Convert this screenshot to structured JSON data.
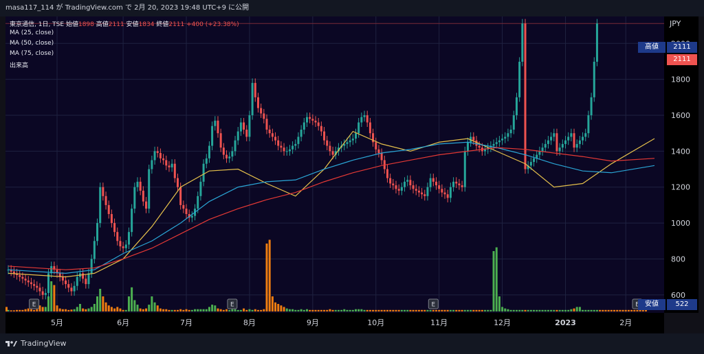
{
  "header": {
    "text": "masa117_114 が TradingView.com で 2月 20, 2023 19:48 UTC+9 に公開"
  },
  "legend": {
    "symbol": "東京通信, 1日, TSE",
    "open_label": "始値",
    "open": "1898",
    "high_label": "高値",
    "high": "2111",
    "low_label": "安値",
    "low": "1834",
    "close_label": "終値",
    "close": "2111",
    "change": "+400 (+23.38%)",
    "ma1": "MA (25, close)",
    "ma2": "MA (50, close)",
    "ma3": "MA (75, close)",
    "volume": "出来高"
  },
  "price_axis": {
    "currency": "JPY",
    "high_tag_label": "高値",
    "high_tag_value": "2111",
    "last_price": "2111",
    "low_tag_label": "安値",
    "low_tag_value": "522"
  },
  "footer": {
    "logo_text": "TradingView"
  },
  "earnings_marker": "E",
  "colors": {
    "up": "#26a69a",
    "down": "#ef5350",
    "ma25": "#e5c04b",
    "ma50": "#2aa6d6",
    "ma75": "#e53935",
    "vol_up": "#4caf50",
    "vol_down": "#ef7d10"
  },
  "chart_data": {
    "type": "candlestick",
    "title": "東京通信, 1日, TSE",
    "ylim": [
      500,
      2150
    ],
    "y_ticks": [
      600,
      800,
      1000,
      1200,
      1400,
      1600,
      1800,
      2000
    ],
    "x_tick_labels": [
      "5月",
      "6月",
      "7月",
      "8月",
      "9月",
      "10月",
      "11月",
      "12月",
      "2023",
      "2月"
    ],
    "x_tick_days": [
      17,
      40,
      62,
      84,
      106,
      128,
      150,
      172,
      194,
      215
    ],
    "earnings_days": [
      9,
      78,
      148,
      219
    ],
    "series": [
      {
        "name": "MA (25, close)",
        "x": [
          0,
          20,
          30,
          40,
          50,
          60,
          70,
          80,
          90,
          100,
          110,
          120,
          130,
          140,
          150,
          160,
          170,
          180,
          190,
          200,
          210,
          225
        ],
        "values": [
          720,
          700,
          720,
          800,
          980,
          1200,
          1290,
          1300,
          1220,
          1150,
          1300,
          1510,
          1440,
          1400,
          1450,
          1470,
          1400,
          1330,
          1200,
          1220,
          1330,
          1470
        ]
      },
      {
        "name": "MA (50, close)",
        "x": [
          0,
          20,
          30,
          40,
          50,
          60,
          70,
          80,
          90,
          100,
          110,
          120,
          130,
          140,
          150,
          160,
          170,
          180,
          190,
          200,
          210,
          225
        ],
        "values": [
          740,
          720,
          740,
          830,
          900,
          1000,
          1120,
          1200,
          1230,
          1240,
          1300,
          1350,
          1390,
          1410,
          1440,
          1450,
          1420,
          1380,
          1330,
          1290,
          1280,
          1320
        ]
      },
      {
        "name": "MA (75, close)",
        "x": [
          0,
          20,
          30,
          40,
          50,
          60,
          70,
          80,
          90,
          100,
          110,
          120,
          130,
          140,
          150,
          160,
          170,
          180,
          190,
          200,
          210,
          225
        ],
        "values": [
          760,
          740,
          750,
          800,
          860,
          940,
          1020,
          1080,
          1130,
          1170,
          1230,
          1280,
          1320,
          1350,
          1380,
          1400,
          1420,
          1410,
          1390,
          1370,
          1345,
          1360
        ]
      }
    ],
    "candles_x": [
      0,
      1,
      2,
      3,
      4,
      5,
      6,
      7,
      8,
      9,
      10,
      11,
      12,
      13,
      14,
      15,
      16,
      17,
      18,
      19,
      20,
      21,
      22,
      23,
      24,
      25,
      26,
      27,
      28,
      29,
      30,
      31,
      32,
      33,
      34,
      35,
      36,
      37,
      38,
      39,
      40,
      41,
      42,
      43,
      44,
      45,
      46,
      47,
      48,
      49,
      50,
      51,
      52,
      53,
      54,
      55,
      56,
      57,
      58,
      59,
      60,
      61,
      62,
      63,
      64,
      65,
      66,
      67,
      68,
      69,
      70,
      71,
      72,
      73,
      74,
      75,
      76,
      77,
      78,
      79,
      80,
      81,
      82,
      83,
      84,
      85,
      86,
      87,
      88,
      89,
      90,
      91,
      92,
      93,
      94,
      95,
      96,
      97,
      98,
      99,
      100,
      101,
      102,
      103,
      104,
      105,
      106,
      107,
      108,
      109,
      110,
      111,
      112,
      113,
      114,
      115,
      116,
      117,
      118,
      119,
      120,
      121,
      122,
      123,
      124,
      125,
      126,
      127,
      128,
      129,
      130,
      131,
      132,
      133,
      134,
      135,
      136,
      137,
      138,
      139,
      140,
      141,
      142,
      143,
      144,
      145,
      146,
      147,
      148,
      149,
      150,
      151,
      152,
      153,
      154,
      155,
      156,
      157,
      158,
      159,
      160,
      161,
      162,
      163,
      164,
      165,
      166,
      167,
      168,
      169,
      170,
      171,
      172,
      173,
      174,
      175,
      176,
      177,
      178,
      179,
      180,
      181,
      182,
      183,
      184,
      185,
      186,
      187,
      188,
      189,
      190,
      191,
      192,
      193,
      194,
      195,
      196,
      197,
      198,
      199,
      200,
      201,
      202,
      203,
      204,
      205,
      206,
      207,
      208,
      209,
      210,
      211,
      212,
      213,
      214,
      215,
      216,
      217,
      218,
      219,
      220,
      221,
      222
    ],
    "close": [
      740,
      730,
      720,
      710,
      700,
      690,
      680,
      670,
      660,
      650,
      640,
      620,
      600,
      610,
      720,
      760,
      740,
      720,
      700,
      680,
      660,
      640,
      620,
      650,
      700,
      720,
      690,
      660,
      720,
      800,
      900,
      1000,
      1200,
      1150,
      1100,
      1050,
      1000,
      950,
      900,
      870,
      860,
      880,
      950,
      1080,
      1200,
      1230,
      1180,
      1120,
      1080,
      1300,
      1350,
      1400,
      1390,
      1360,
      1350,
      1320,
      1310,
      1330,
      1250,
      1200,
      1100,
      1080,
      1050,
      1030,
      1040,
      1080,
      1150,
      1230,
      1330,
      1360,
      1430,
      1540,
      1570,
      1500,
      1420,
      1380,
      1360,
      1370,
      1400,
      1460,
      1510,
      1560,
      1520,
      1480,
      1600,
      1780,
      1700,
      1640,
      1610,
      1580,
      1520,
      1500,
      1480,
      1460,
      1430,
      1420,
      1400,
      1400,
      1410,
      1430,
      1440,
      1480,
      1520,
      1560,
      1590,
      1580,
      1570,
      1560,
      1540,
      1510,
      1460,
      1430,
      1400,
      1380,
      1400,
      1420,
      1430,
      1440,
      1450,
      1460,
      1470,
      1500,
      1560,
      1590,
      1600,
      1560,
      1500,
      1450,
      1410,
      1390,
      1350,
      1300,
      1250,
      1220,
      1210,
      1190,
      1180,
      1200,
      1230,
      1240,
      1210,
      1190,
      1180,
      1170,
      1160,
      1150,
      1200,
      1250,
      1230,
      1210,
      1190,
      1170,
      1160,
      1140,
      1200,
      1230,
      1220,
      1210,
      1200,
      1400,
      1450,
      1480,
      1460,
      1430,
      1420,
      1400,
      1410,
      1420,
      1430,
      1440,
      1450,
      1460,
      1470,
      1480,
      1500,
      1520,
      1600,
      1700,
      1898,
      2111,
      1300,
      1320,
      1340,
      1360,
      1380,
      1400,
      1420,
      1440,
      1460,
      1480,
      1500,
      1400,
      1420,
      1440,
      1460,
      1480,
      1500,
      1420,
      1440,
      1460,
      1480,
      1500,
      1600,
      1700,
      1898,
      2111
    ],
    "volume_label": "出来高",
    "volume_ymax": 1000,
    "volume": [
      20,
      15,
      15,
      20,
      20,
      20,
      30,
      40,
      30,
      20,
      30,
      80,
      60,
      60,
      200,
      400,
      350,
      80,
      40,
      30,
      30,
      20,
      25,
      30,
      60,
      100,
      40,
      30,
      40,
      60,
      100,
      200,
      300,
      200,
      120,
      80,
      60,
      40,
      60,
      40,
      20,
      20,
      200,
      320,
      150,
      90,
      40,
      30,
      40,
      90,
      200,
      120,
      80,
      40,
      30,
      30,
      20,
      20,
      20,
      20,
      30,
      20,
      30,
      20,
      20,
      30,
      30,
      30,
      30,
      30,
      60,
      90,
      80,
      40,
      30,
      20,
      30,
      20,
      30,
      30,
      20,
      20,
      40,
      20,
      30,
      20,
      30,
      20,
      20,
      30,
      900,
      950,
      200,
      120,
      100,
      80,
      60,
      40,
      30,
      30,
      20,
      20,
      30,
      20,
      30,
      20,
      20,
      20,
      20,
      20,
      20,
      20,
      30,
      20,
      20,
      20,
      20,
      30,
      20,
      20,
      20,
      30,
      30,
      30,
      20,
      20,
      20,
      20,
      20,
      20,
      20,
      20,
      20,
      20,
      20,
      20,
      20,
      20,
      20,
      20,
      20,
      20,
      20,
      20,
      20,
      20,
      20,
      20,
      20,
      20,
      20,
      20,
      20,
      20,
      20,
      20,
      20,
      20,
      20,
      20,
      20,
      20,
      20,
      20,
      20,
      20,
      20,
      20,
      20,
      800,
      850,
      200,
      60,
      40,
      30,
      20,
      20,
      20,
      20,
      20,
      20,
      20,
      20,
      20,
      20,
      20,
      20,
      20,
      20,
      20,
      20,
      20,
      20,
      20,
      20,
      20,
      30,
      40,
      60,
      60,
      20,
      20,
      20,
      20,
      20,
      20,
      20,
      20,
      20,
      20,
      20,
      20,
      20,
      20,
      20,
      20,
      20,
      20,
      20,
      20,
      20,
      20,
      20,
      20,
      20,
      20,
      20,
      30,
      40,
      60
    ]
  }
}
